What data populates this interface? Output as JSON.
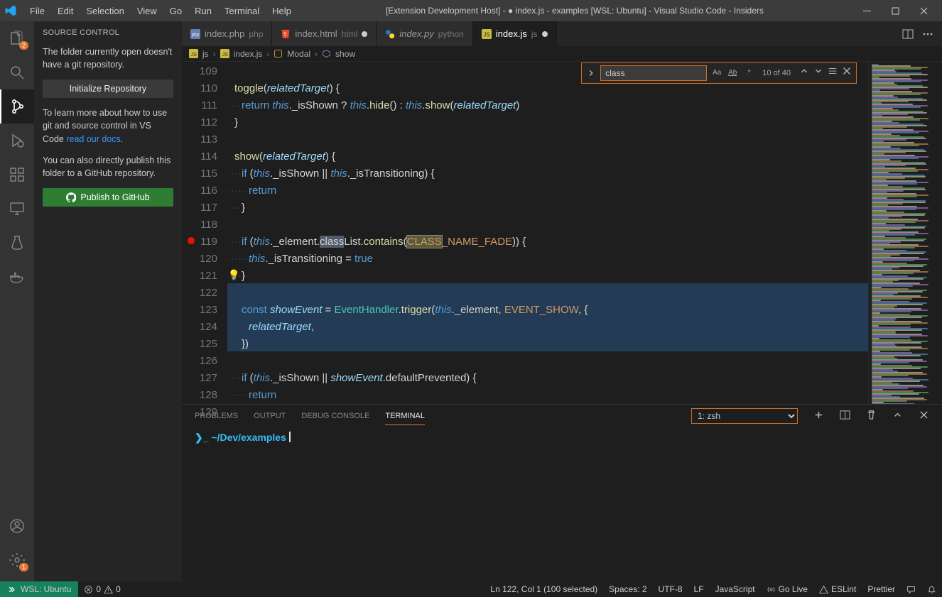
{
  "window": {
    "title": "[Extension Development Host] - ● index.js - examples [WSL: Ubuntu] - Visual Studio Code - Insiders",
    "menu": [
      "File",
      "Edit",
      "Selection",
      "View",
      "Go",
      "Run",
      "Terminal",
      "Help"
    ]
  },
  "activity": {
    "explorer_badge": "2",
    "gear_badge": "1"
  },
  "sidebar": {
    "title": "SOURCE CONTROL",
    "para1": "The folder currently open doesn't have a git repository.",
    "init_btn": "Initialize Repository",
    "para2_a": "To learn more about how to use git and source control in VS Code ",
    "para2_link": "read our docs",
    "para2_b": ".",
    "para3": "You can also directly publish this folder to a GitHub repository.",
    "publish_btn": "Publish to GitHub"
  },
  "tabs": [
    {
      "name": "index.php",
      "lang": "php",
      "dirty": false,
      "icon": "php"
    },
    {
      "name": "index.html",
      "lang": "html",
      "dirty": true,
      "icon": "html"
    },
    {
      "name": "index.py",
      "lang": "python",
      "dirty": false,
      "italic": true,
      "icon": "py"
    },
    {
      "name": "index.js",
      "lang": "js",
      "dirty": true,
      "active": true,
      "icon": "js"
    }
  ],
  "breadcrumbs": [
    "js",
    "index.js",
    "Modal",
    "show"
  ],
  "find": {
    "value": "class",
    "count": "10 of 40"
  },
  "code": {
    "first_line": 109,
    "lines": [
      "",
      "  toggle(relatedTarget) {",
      "    return this._isShown ? this.hide() : this.show(relatedTarget)",
      "  }",
      "",
      "  show(relatedTarget) {",
      "    if (this._isShown || this._isTransitioning) {",
      "      return",
      "    }",
      "",
      "    if (this._element.classList.contains(CLASS_NAME_FADE)) {",
      "      this._isTransitioning = true",
      "    }",
      "",
      "    const showEvent = EventHandler.trigger(this._element, EVENT_SHOW, {",
      "      relatedTarget,",
      "    })",
      "",
      "    if (this._isShown || showEvent.defaultPrevented) {",
      "      return",
      "    }"
    ],
    "breakpoint_line": 119,
    "lightbulb_line": 121,
    "selection_lines": [
      122,
      123,
      124,
      125
    ]
  },
  "panel": {
    "tabs": [
      "PROBLEMS",
      "OUTPUT",
      "DEBUG CONSOLE",
      "TERMINAL"
    ],
    "active": "TERMINAL",
    "shell": "1: zsh",
    "prompt_symbol": "❯_",
    "prompt_path": "~/Dev/examples"
  },
  "status": {
    "wsl": "WSL: Ubuntu",
    "errs": "0",
    "warns": "0",
    "pos": "Ln 122, Col 1 (100 selected)",
    "indent": "Spaces: 2",
    "enc": "UTF-8",
    "eol": "LF",
    "lang": "JavaScript",
    "golive": "Go Live",
    "eslint": "ESLint",
    "prettier": "Prettier"
  }
}
